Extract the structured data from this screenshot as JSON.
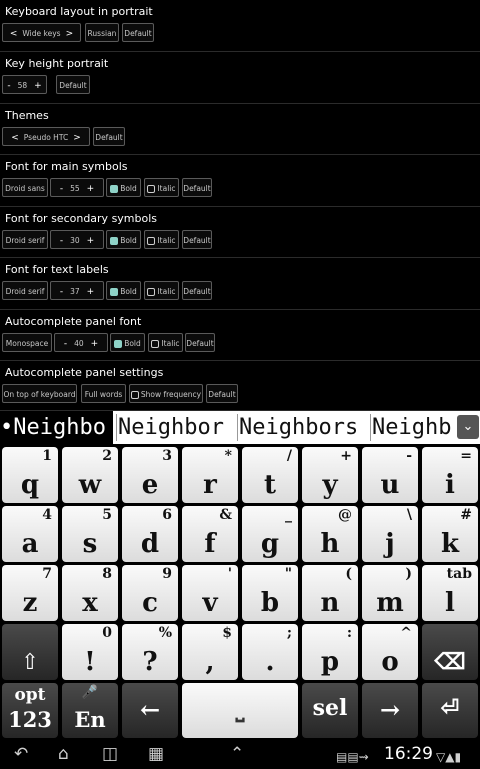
{
  "sections": [
    {
      "title": "Keyboard layout in portrait",
      "controls": [
        {
          "type": "spinner",
          "value": "Wide keys"
        },
        {
          "type": "button",
          "label": "Russian"
        },
        {
          "type": "button",
          "label": "Default"
        }
      ]
    },
    {
      "title": "Key height portrait",
      "controls": [
        {
          "type": "stepper",
          "value": "58"
        },
        {
          "type": "button",
          "label": "Default"
        }
      ]
    },
    {
      "title": "Themes",
      "controls": [
        {
          "type": "spinner",
          "value": "Pseudo HTC"
        },
        {
          "type": "button",
          "label": "Default"
        }
      ]
    },
    {
      "title": "Font for main symbols",
      "controls": [
        {
          "type": "button",
          "label": "Droid sans"
        },
        {
          "type": "stepper",
          "value": "55"
        },
        {
          "type": "checkbox",
          "label": "Bold",
          "checked": true
        },
        {
          "type": "checkbox",
          "label": "Italic",
          "checked": false
        },
        {
          "type": "button",
          "label": "Default"
        }
      ]
    },
    {
      "title": "Font for secondary symbols",
      "controls": [
        {
          "type": "button",
          "label": "Droid serif"
        },
        {
          "type": "stepper",
          "value": "30"
        },
        {
          "type": "checkbox",
          "label": "Bold",
          "checked": true
        },
        {
          "type": "checkbox",
          "label": "Italic",
          "checked": false
        },
        {
          "type": "button",
          "label": "Default"
        }
      ]
    },
    {
      "title": "Font for text labels",
      "controls": [
        {
          "type": "button",
          "label": "Droid serif"
        },
        {
          "type": "stepper",
          "value": "37"
        },
        {
          "type": "checkbox",
          "label": "Bold",
          "checked": true
        },
        {
          "type": "checkbox",
          "label": "Italic",
          "checked": false
        },
        {
          "type": "button",
          "label": "Default"
        }
      ]
    },
    {
      "title": "Autocomplete panel font",
      "controls": [
        {
          "type": "button",
          "label": "Monospace"
        },
        {
          "type": "stepper",
          "value": "40"
        },
        {
          "type": "checkbox",
          "label": "Bold",
          "checked": true
        },
        {
          "type": "checkbox",
          "label": "Italic",
          "checked": false
        },
        {
          "type": "button",
          "label": "Default"
        }
      ]
    },
    {
      "title": "Autocomplete panel settings",
      "controls": [
        {
          "type": "button",
          "label": "On top of keyboard"
        },
        {
          "type": "button",
          "label": "Full words"
        },
        {
          "type": "checkbox",
          "label": "Show frequency",
          "checked": false
        },
        {
          "type": "button",
          "label": "Default"
        }
      ]
    }
  ],
  "stepper": {
    "minus": "-",
    "plus": "+"
  },
  "spinner": {
    "left": "<",
    "right": ">"
  },
  "suggestions": [
    "•Neighbo",
    "Neighbor",
    "Neighbors",
    "Neighb"
  ],
  "suggestion_more_icon": "chevron-down-icon",
  "keyboard": {
    "rows": [
      [
        {
          "m": "q",
          "a": "1"
        },
        {
          "m": "w",
          "a": "2"
        },
        {
          "m": "e",
          "a": "3"
        },
        {
          "m": "r",
          "a": "*"
        },
        {
          "m": "t",
          "a": "/"
        },
        {
          "m": "y",
          "a": "+"
        },
        {
          "m": "u",
          "a": "-"
        },
        {
          "m": "i",
          "a": "="
        }
      ],
      [
        {
          "m": "a",
          "a": "4"
        },
        {
          "m": "s",
          "a": "5"
        },
        {
          "m": "d",
          "a": "6"
        },
        {
          "m": "f",
          "a": "&"
        },
        {
          "m": "g",
          "a": "_"
        },
        {
          "m": "h",
          "a": "@"
        },
        {
          "m": "j",
          "a": "\\"
        },
        {
          "m": "k",
          "a": "#"
        }
      ],
      [
        {
          "m": "z",
          "a": "7"
        },
        {
          "m": "x",
          "a": "8"
        },
        {
          "m": "c",
          "a": "9"
        },
        {
          "m": "v",
          "a": "'"
        },
        {
          "m": "b",
          "a": "\""
        },
        {
          "m": "n",
          "a": "("
        },
        {
          "m": "m",
          "a": ")"
        },
        {
          "m": "l",
          "a": "tab"
        }
      ],
      [
        {
          "m": "⇧",
          "a": "",
          "dark": true,
          "icon": "shift-icon"
        },
        {
          "m": "!",
          "a": "0"
        },
        {
          "m": "?",
          "a": "%"
        },
        {
          "m": ",",
          "a": "$"
        },
        {
          "m": ".",
          "a": ";"
        },
        {
          "m": "p",
          "a": ":"
        },
        {
          "m": "o",
          "a": "^"
        },
        {
          "m": "⌫",
          "a": "",
          "dark": true,
          "icon": "backspace-icon"
        }
      ]
    ],
    "bottom": {
      "opt": "opt",
      "num": "123",
      "lang": "En",
      "left": "←",
      "space": "⎵",
      "sel": "sel",
      "right": "→",
      "enter": "⏎"
    }
  },
  "status": {
    "time": "16:29"
  }
}
